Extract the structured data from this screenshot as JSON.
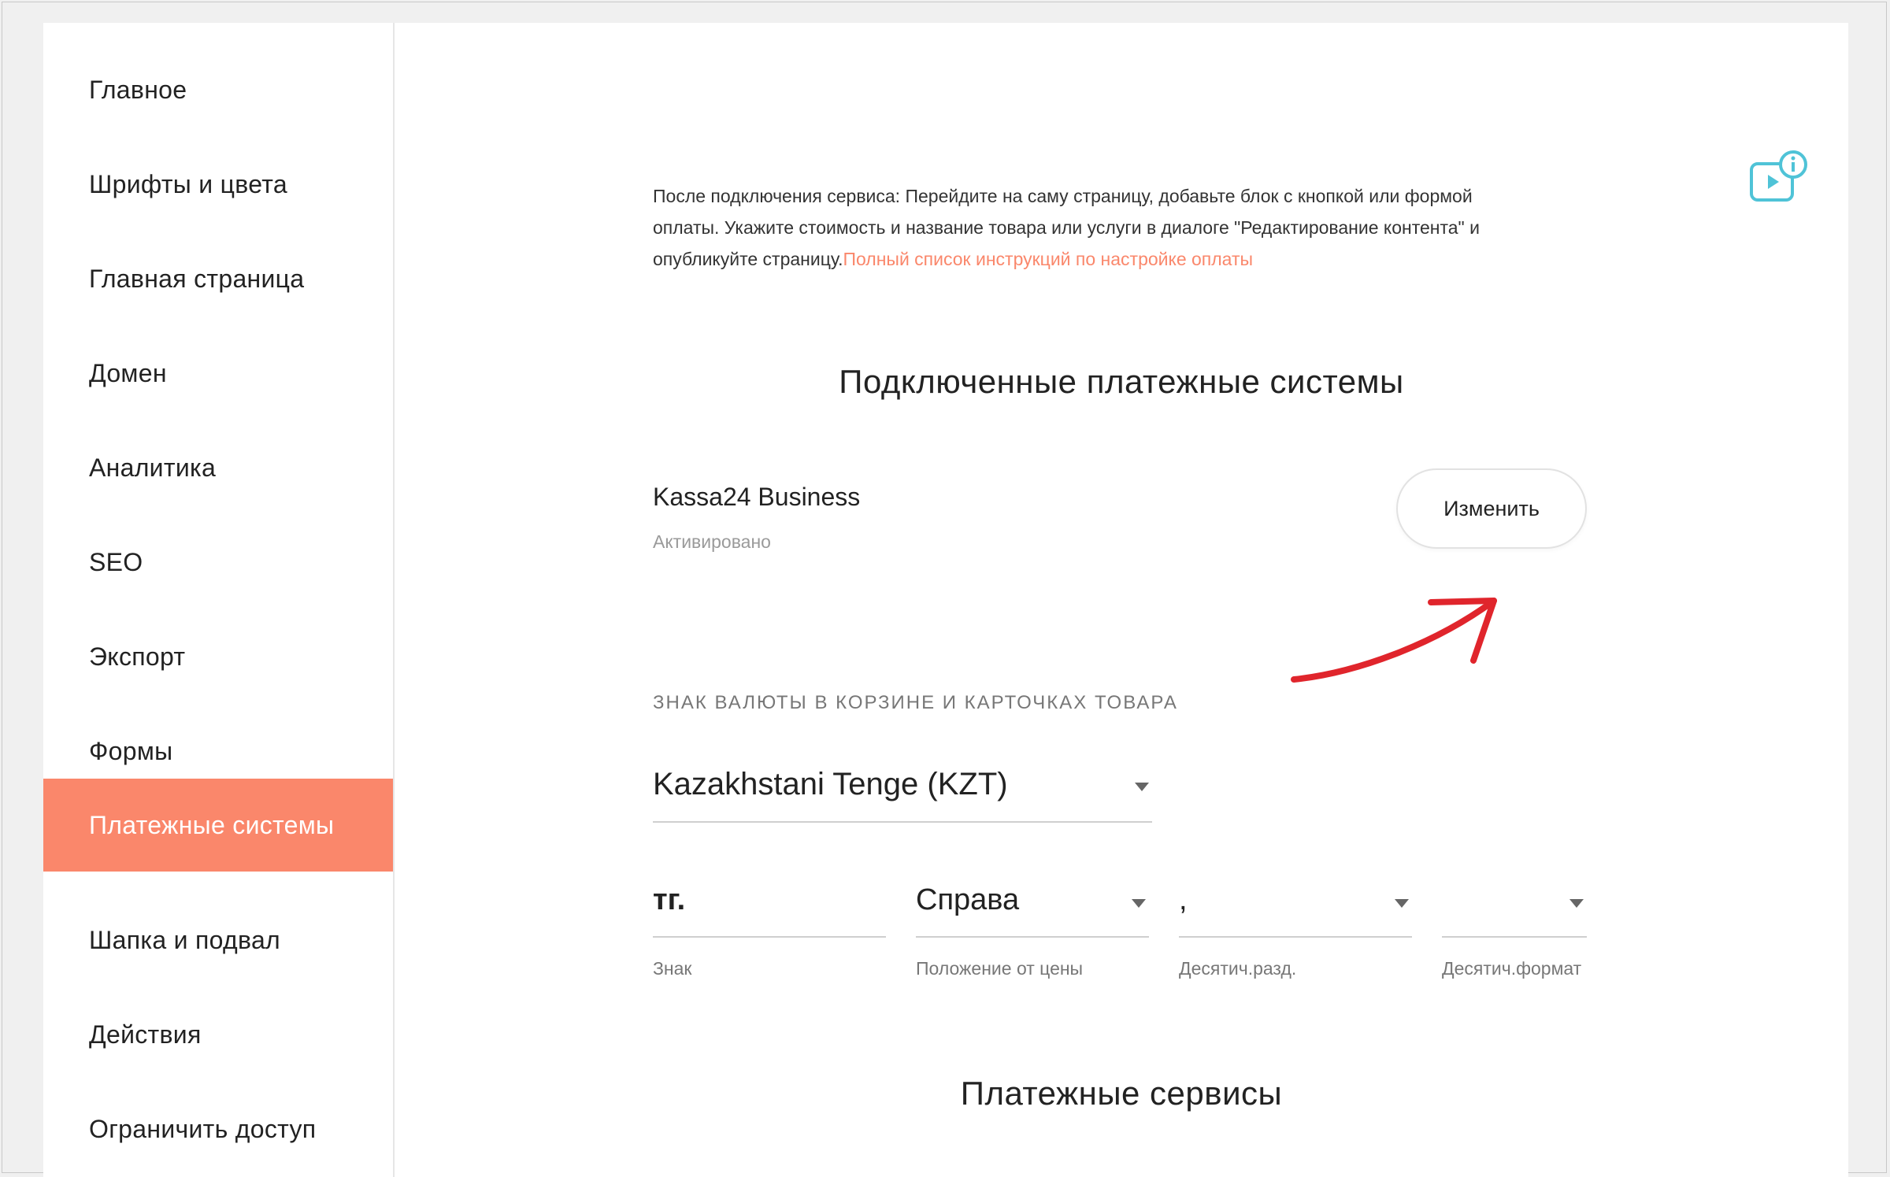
{
  "sidebar": {
    "items": [
      {
        "label": "Главное",
        "active": false
      },
      {
        "label": "Шрифты и цвета",
        "active": false
      },
      {
        "label": "Главная страница",
        "active": false
      },
      {
        "label": "Домен",
        "active": false
      },
      {
        "label": "Аналитика",
        "active": false
      },
      {
        "label": "SEO",
        "active": false
      },
      {
        "label": "Экспорт",
        "active": false
      },
      {
        "label": "Формы",
        "active": false
      },
      {
        "label": "Платежные системы",
        "active": true
      },
      {
        "label": "Шапка и подвал",
        "active": false
      },
      {
        "label": "Действия",
        "active": false
      },
      {
        "label": "Ограничить доступ",
        "active": false
      }
    ]
  },
  "main": {
    "intro_text": "После подключения сервиса: Перейдите на саму страницу, добавьте блок с кнопкой или формой оплаты. Укажите стоимость и название товара или услуги в диалоге \"Редактирование контента\" и опубликуйте страницу.",
    "intro_link": "Полный список инструкций по настройке оплаты",
    "connected_title": "Подключенные платежные системы",
    "payment_system": {
      "name": "Kassa24 Business",
      "status": "Активировано",
      "edit_label": "Изменить"
    },
    "currency_section_label": "ЗНАК ВАЛЮТЫ В КОРЗИНЕ И КАРТОЧКАХ ТОВАРА",
    "currency_select": "Kazakhstani Tenge (KZT)",
    "currency_fields": {
      "sign": {
        "value": "тг.",
        "label": "Знак"
      },
      "position": {
        "value": "Справа",
        "label": "Положение от цены"
      },
      "decimal_separator": {
        "value": ",",
        "label": "Десятич.разд."
      },
      "decimal_format": {
        "value": "",
        "label": "Десятич.формат"
      }
    },
    "services_title": "Платежные сервисы"
  },
  "icons": {
    "video_help": "video-info-icon",
    "dropdown": "chevron-down-icon",
    "annotation": "arrow-annotation-icon"
  },
  "colors": {
    "accent": "#fa876b",
    "help_icon": "#4fc3d7",
    "annotation_arrow": "#e0252c"
  }
}
